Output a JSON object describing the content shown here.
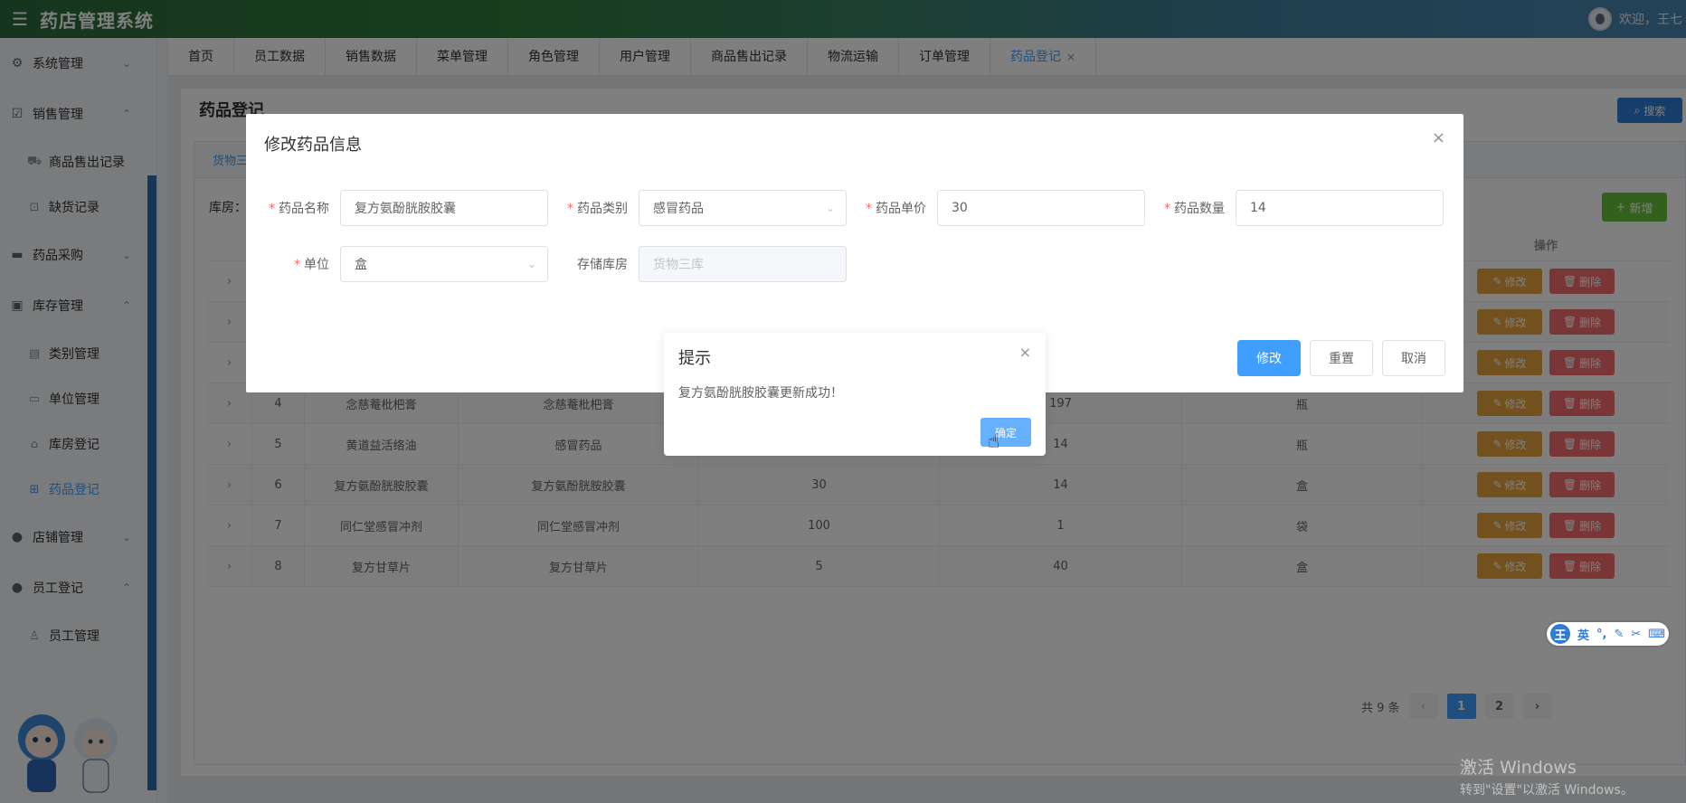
{
  "header": {
    "title": "药店管理系统",
    "welcome": "欢迎，王七"
  },
  "sidebar": {
    "groups": [
      {
        "label": "系统管理",
        "icon": "gear-icon",
        "arrow": "⌄"
      },
      {
        "label": "销售管理",
        "icon": "chart-icon",
        "arrow": "⌃"
      },
      {
        "label": "药品采购",
        "icon": "cart-icon",
        "arrow": "⌄"
      },
      {
        "label": "库存管理",
        "icon": "briefcase-icon",
        "arrow": "⌃"
      },
      {
        "label": "店铺管理",
        "icon": "user-icon",
        "arrow": "⌄"
      },
      {
        "label": "员工登记",
        "icon": "user-icon",
        "arrow": "⌃"
      }
    ],
    "sales_sub": [
      "商品售出记录",
      "缺货记录"
    ],
    "inventory_sub": [
      "类别管理",
      "单位管理",
      "库房登记",
      "药品登记"
    ],
    "staff_sub": [
      "员工管理"
    ]
  },
  "tabs": [
    "首页",
    "员工数据",
    "销售数据",
    "菜单管理",
    "角色管理",
    "用户管理",
    "商品售出记录",
    "物流运输",
    "订单管理",
    "药品登记"
  ],
  "page": {
    "title": "药品登记",
    "search_label": "搜索",
    "inner_tab": "货物三库",
    "storeroom_label": "库房：",
    "add_label": "新增",
    "ops_header": "操作",
    "edit_label": "修改",
    "delete_label": "删除"
  },
  "table": {
    "rows": [
      {
        "idx": "",
        "name": "",
        "alias": "",
        "price": "",
        "qty": "",
        "unit": ""
      },
      {
        "idx": "",
        "name": "",
        "alias": "",
        "price": "",
        "qty": "",
        "unit": ""
      },
      {
        "idx": "",
        "name": "",
        "alias": "",
        "price": "",
        "qty": "",
        "unit": ""
      },
      {
        "idx": "4",
        "name": "念慈菴枇杷膏",
        "alias": "念慈菴枇杷膏",
        "price": "",
        "qty": "197",
        "unit": "瓶"
      },
      {
        "idx": "5",
        "name": "黄道益活络油",
        "alias": "感冒药品",
        "price": "",
        "qty": "14",
        "unit": "瓶"
      },
      {
        "idx": "6",
        "name": "复方氨酚胱胺胶囊",
        "alias": "复方氨酚胱胺胶囊",
        "price": "30",
        "qty": "14",
        "unit": "盒"
      },
      {
        "idx": "7",
        "name": "同仁堂感冒冲剂",
        "alias": "同仁堂感冒冲剂",
        "price": "100",
        "qty": "1",
        "unit": "袋"
      },
      {
        "idx": "8",
        "name": "复方甘草片",
        "alias": "复方甘草片",
        "price": "5",
        "qty": "40",
        "unit": "盒"
      }
    ]
  },
  "pagination": {
    "total": "共 9 条",
    "pages": [
      "1",
      "2"
    ],
    "prev": "‹",
    "next": "›"
  },
  "edit_dialog": {
    "title": "修改药品信息",
    "fields": {
      "name": {
        "label": "药品名称",
        "value": "复方氨酚胱胺胶囊"
      },
      "category": {
        "label": "药品类别",
        "value": "感冒药品"
      },
      "price": {
        "label": "药品单价",
        "value": "30"
      },
      "qty": {
        "label": "药品数量",
        "value": "14"
      },
      "unit": {
        "label": "单位",
        "value": "盒"
      },
      "store": {
        "label": "存储库房",
        "value": "货物三库"
      }
    },
    "buttons": {
      "submit": "修改",
      "reset": "重置",
      "cancel": "取消"
    }
  },
  "message_box": {
    "title": "提示",
    "text": "复方氨酚胱胺胶囊更新成功！",
    "ok": "确定"
  },
  "ime": {
    "logo": "王",
    "lang": "英",
    "items": [
      "°,",
      "✎",
      "✂",
      "⌨"
    ]
  },
  "watermark": {
    "line1": "激活 Windows",
    "line2": "转到\"设置\"以激活 Windows。"
  },
  "colors": {
    "primary": "#409eff",
    "success": "#67c23a",
    "warning": "#e6a23c",
    "danger": "#f56c6c"
  }
}
